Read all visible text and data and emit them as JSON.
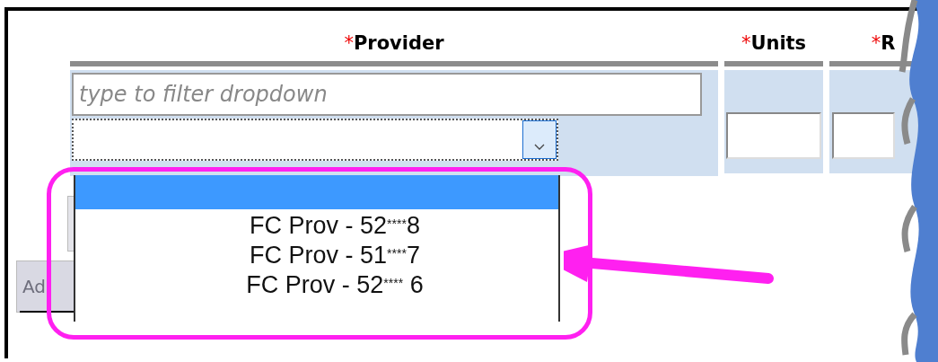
{
  "table": {
    "columns": [
      {
        "required_mark": "*",
        "label": "Provider"
      },
      {
        "required_mark": "*",
        "label": "Units"
      },
      {
        "required_mark": "*",
        "label": "R"
      }
    ]
  },
  "provider_filter": {
    "placeholder": "type to filter dropdown"
  },
  "provider_select": {
    "expanded": true,
    "options": [
      {
        "selected": true
      },
      {
        "label": "FC Prov - 52$^{****}$8",
        "selected": false
      },
      {
        "label": "FC Prov - 51$^{****}$7",
        "selected": false
      },
      {
        "label": "FC Prov - 52$^{****}$ 6",
        "selected": false
      }
    ]
  },
  "add_button": {
    "label": "Ad",
    "disabled": true
  }
}
